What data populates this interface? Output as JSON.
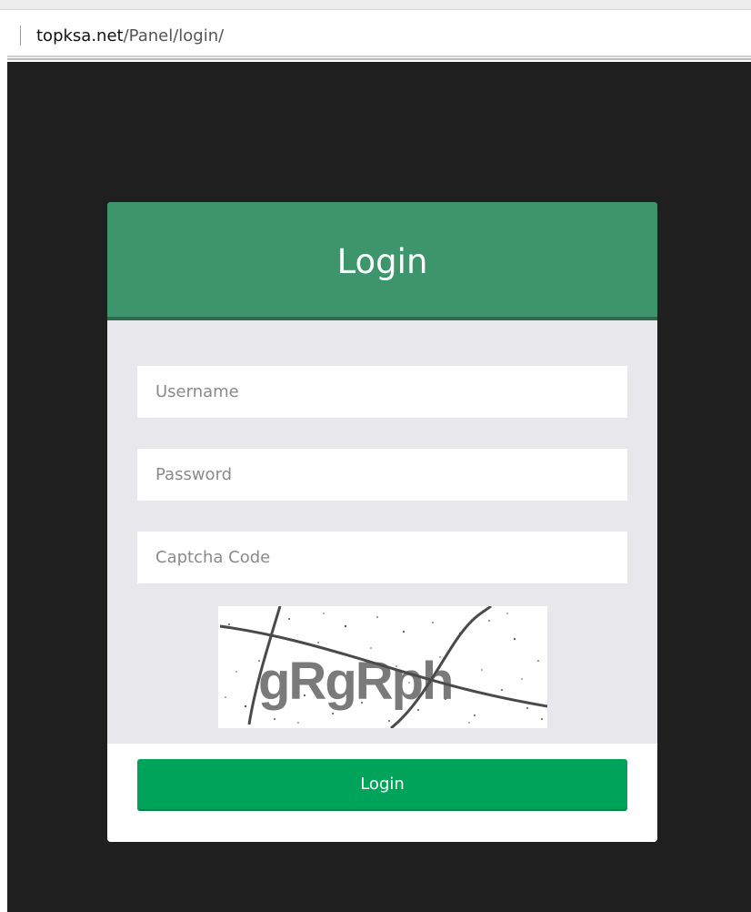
{
  "address_bar": {
    "domain": "topksa.net",
    "path": "/Panel/login/"
  },
  "login_form": {
    "title": "Login",
    "username_placeholder": "Username",
    "password_placeholder": "Password",
    "captcha_placeholder": "Captcha Code",
    "captcha_text": "gRgRph",
    "submit_label": "Login"
  },
  "colors": {
    "header": "#3d956b",
    "button": "#00a35a",
    "backdrop": "#1f1f1f",
    "body": "#e8e8ec"
  }
}
